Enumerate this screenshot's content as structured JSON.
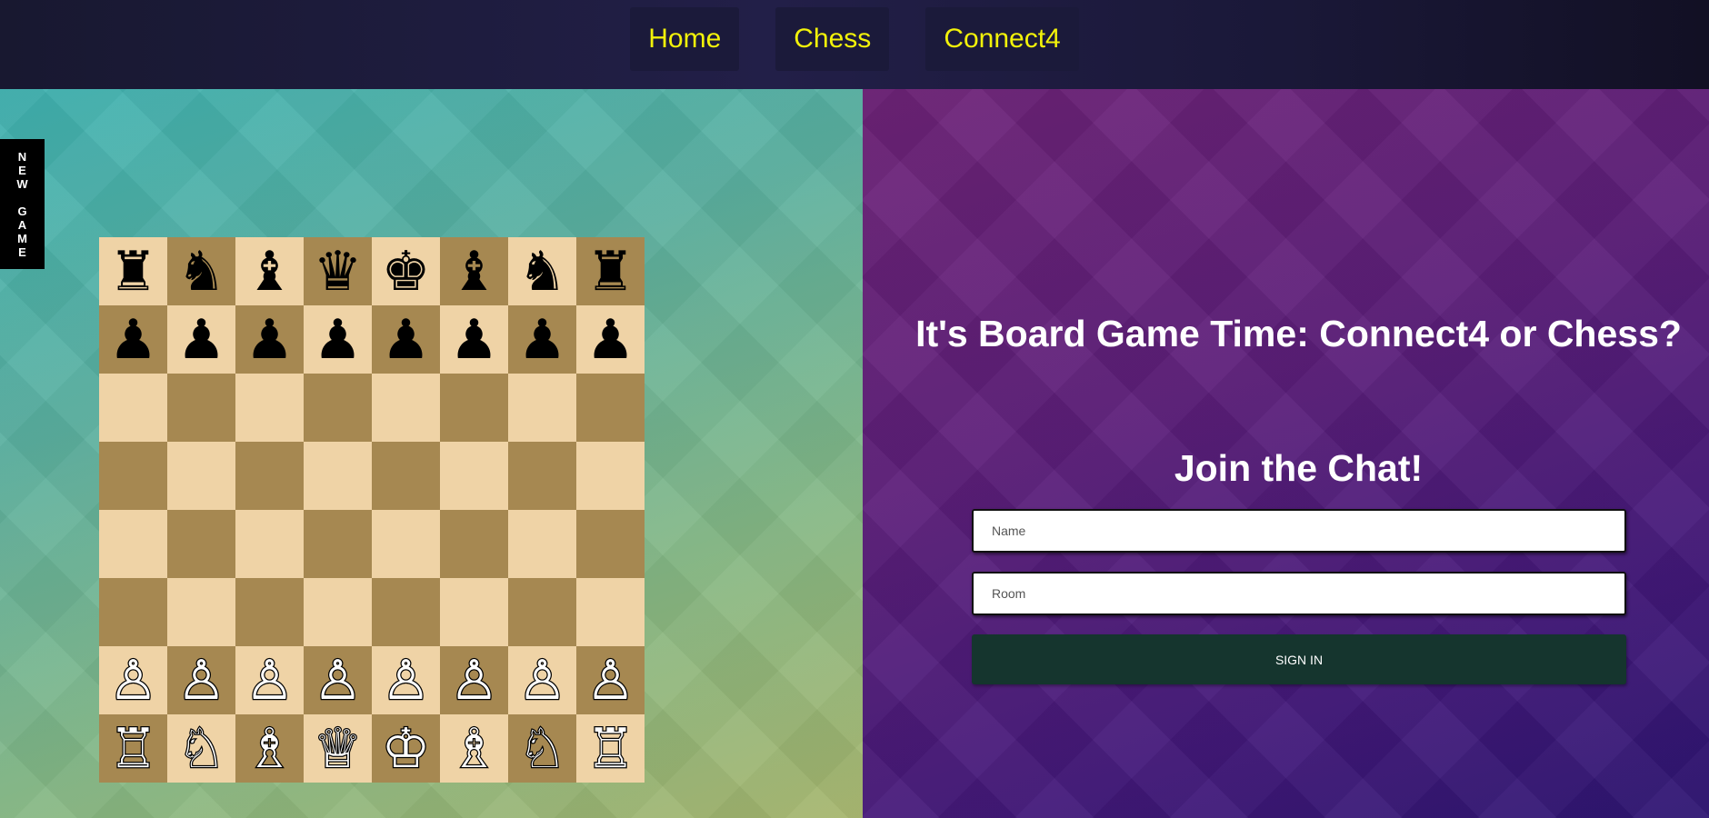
{
  "nav": {
    "items": [
      {
        "label": "Home"
      },
      {
        "label": "Chess"
      },
      {
        "label": "Connect4"
      }
    ]
  },
  "new_game": {
    "letters": [
      "N",
      "E",
      "W",
      "",
      "G",
      "A",
      "M",
      "E"
    ]
  },
  "board": {
    "square_colors": {
      "light": "#efd3a6",
      "dark": "#a68851"
    },
    "rows": [
      [
        "♜",
        "♞",
        "♝",
        "♛",
        "♚",
        "♝",
        "♞",
        "♜"
      ],
      [
        "♟",
        "♟",
        "♟",
        "♟",
        "♟",
        "♟",
        "♟",
        "♟"
      ],
      [
        "",
        "",
        "",
        "",
        "",
        "",
        "",
        ""
      ],
      [
        "",
        "",
        "",
        "",
        "",
        "",
        "",
        ""
      ],
      [
        "",
        "",
        "",
        "",
        "",
        "",
        "",
        ""
      ],
      [
        "",
        "",
        "",
        "",
        "",
        "",
        "",
        ""
      ],
      [
        "♙",
        "♙",
        "♙",
        "♙",
        "♙",
        "♙",
        "♙",
        "♙"
      ],
      [
        "♖",
        "♘",
        "♗",
        "♕",
        "♔",
        "♗",
        "♘",
        "♖"
      ]
    ],
    "piece_colors": [
      [
        "black",
        "black",
        "black",
        "black",
        "black",
        "black",
        "black",
        "black"
      ],
      [
        "black",
        "black",
        "black",
        "black",
        "black",
        "black",
        "black",
        "black"
      ],
      [
        "",
        "",
        "",
        "",
        "",
        "",
        "",
        ""
      ],
      [
        "",
        "",
        "",
        "",
        "",
        "",
        "",
        ""
      ],
      [
        "",
        "",
        "",
        "",
        "",
        "",
        "",
        ""
      ],
      [
        "",
        "",
        "",
        "",
        "",
        "",
        "",
        ""
      ],
      [
        "white",
        "white",
        "white",
        "white",
        "white",
        "white",
        "white",
        "white"
      ],
      [
        "white",
        "white",
        "white",
        "white",
        "white",
        "white",
        "white",
        "white"
      ]
    ]
  },
  "chat": {
    "headline": "It's Board Game Time: Connect4 or Chess?",
    "subheadline": "Join the Chat!",
    "name_placeholder": "Name",
    "room_placeholder": "Room",
    "sign_in_label": "SIGN IN"
  },
  "colors": {
    "nav_text": "#f2f20a",
    "sign_in_bg": "#15352e"
  }
}
